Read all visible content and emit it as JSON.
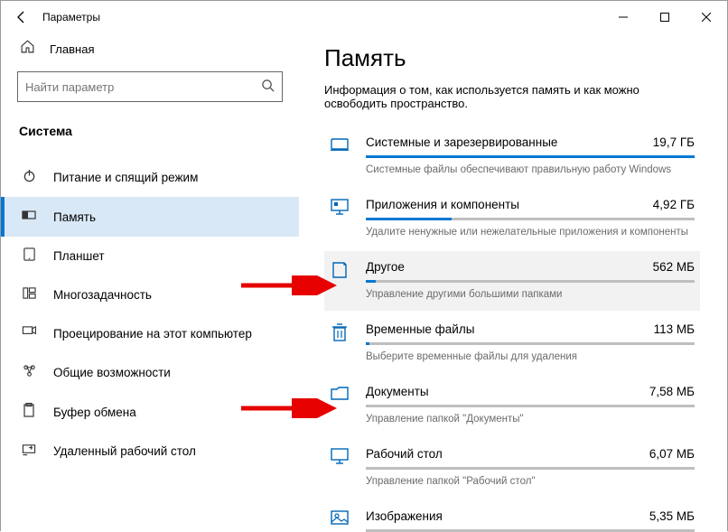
{
  "window": {
    "title": "Параметры"
  },
  "sidebar": {
    "home": "Главная",
    "search_placeholder": "Найти параметр",
    "section": "Система",
    "items": [
      {
        "label": "Питание и спящий режим"
      },
      {
        "label": "Память"
      },
      {
        "label": "Планшет"
      },
      {
        "label": "Многозадачность"
      },
      {
        "label": "Проецирование на этот компьютер"
      },
      {
        "label": "Общие возможности"
      },
      {
        "label": "Буфер обмена"
      },
      {
        "label": "Удаленный рабочий стол"
      }
    ]
  },
  "main": {
    "heading": "Память",
    "subtitle": "Информация о том, как используется память и как можно освободить пространство.",
    "categories": [
      {
        "name": "Системные и зарезервированные",
        "size": "19,7 ГБ",
        "desc": "Системные файлы обеспечивают правильную работу Windows",
        "fill": 100
      },
      {
        "name": "Приложения и компоненты",
        "size": "4,92 ГБ",
        "desc": "Удалите ненужные или нежелательные приложения и компоненты",
        "fill": 26
      },
      {
        "name": "Другое",
        "size": "562 МБ",
        "desc": "Управление другими большими папками",
        "fill": 3
      },
      {
        "name": "Временные файлы",
        "size": "113 МБ",
        "desc": "Выберите временные файлы для удаления",
        "fill": 1
      },
      {
        "name": "Документы",
        "size": "7,58 МБ",
        "desc": "Управление папкой \"Документы\"",
        "fill": 0
      },
      {
        "name": "Рабочий стол",
        "size": "6,07 МБ",
        "desc": "Управление папкой \"Рабочий стол\"",
        "fill": 0
      },
      {
        "name": "Изображения",
        "size": "5,35 МБ",
        "desc": "",
        "fill": 0
      }
    ]
  }
}
